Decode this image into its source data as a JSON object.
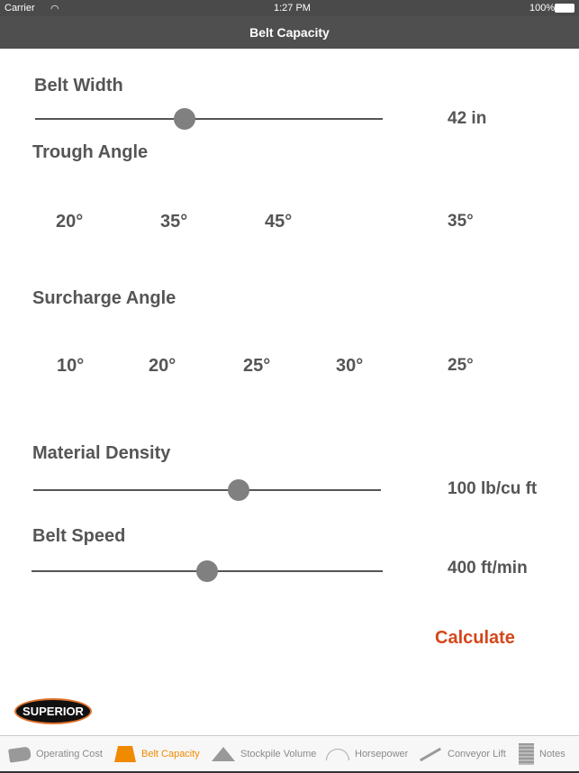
{
  "status": {
    "carrier": "Carrier",
    "time": "1:27 PM",
    "battery": "100%"
  },
  "nav": {
    "title": "Belt Capacity"
  },
  "belt_width": {
    "label": "Belt Width",
    "value": "42 in",
    "fraction": 0.43
  },
  "trough_angle": {
    "label": "Trough Angle",
    "options": [
      "20°",
      "35°",
      "45°"
    ],
    "value": "35°"
  },
  "surcharge_angle": {
    "label": "Surcharge Angle",
    "options": [
      "10°",
      "20°",
      "25°",
      "30°"
    ],
    "value": "25°"
  },
  "material_density": {
    "label": "Material Density",
    "value": "100 lb/cu ft",
    "fraction": 0.59
  },
  "belt_speed": {
    "label": "Belt Speed",
    "value": "400 ft/min",
    "fraction": 0.5
  },
  "calculate_label": "Calculate",
  "logo_text": "SUPERIOR",
  "colors": {
    "accent": "#d4471a",
    "tab_active": "#f08a00"
  },
  "tabs": [
    {
      "label": "Operating Cost",
      "icon": "tag-icon"
    },
    {
      "label": "Belt Capacity",
      "icon": "weight-icon",
      "active": true
    },
    {
      "label": "Stockpile Volume",
      "icon": "pile-icon"
    },
    {
      "label": "Horsepower",
      "icon": "gauge-icon"
    },
    {
      "label": "Conveyor Lift",
      "icon": "incline-icon"
    },
    {
      "label": "Notes",
      "icon": "notes-icon"
    }
  ]
}
